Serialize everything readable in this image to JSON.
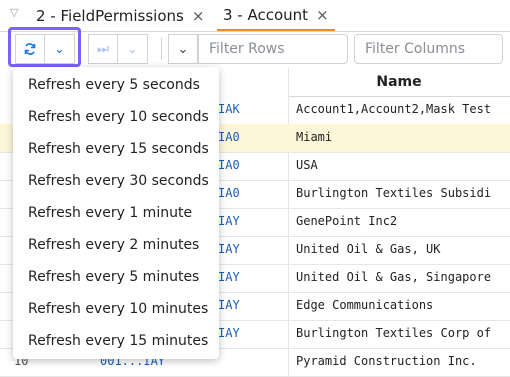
{
  "tabs": [
    {
      "label": "2 - FieldPermissions",
      "close": "×"
    },
    {
      "label": "3 - Account",
      "close": "×"
    }
  ],
  "toolbar": {
    "filter_rows_placeholder": "Filter Rows",
    "filter_columns_placeholder": "Filter Columns"
  },
  "grid": {
    "name_header": "Name",
    "rows": [
      {
        "id": "IAK",
        "name": "Account1,Account2,Mask Test"
      },
      {
        "id": "IA0",
        "name": "Miami"
      },
      {
        "id": "IA0",
        "name": "USA"
      },
      {
        "id": "IA0",
        "name": "Burlington Textiles Subsidi"
      },
      {
        "id": "IAY",
        "name": "GenePoint Inc2"
      },
      {
        "id": "IAY",
        "name": "United Oil & Gas, UK"
      },
      {
        "id": "IAY",
        "name": "United Oil & Gas, Singapore"
      },
      {
        "id": "IAY",
        "name": "Edge Communications"
      },
      {
        "id": "IAY",
        "name": "Burlington Textiles Corp of"
      },
      {
        "num": "10",
        "id": "001...IAY",
        "name": "Pyramid Construction Inc."
      }
    ]
  },
  "refresh_menu": {
    "items": [
      "Refresh every 5 seconds",
      "Refresh every 10 seconds",
      "Refresh every 15 seconds",
      "Refresh every 30 seconds",
      "Refresh every 1 minute",
      "Refresh every 2 minutes",
      "Refresh every 5 minutes",
      "Refresh every 10 minutes",
      "Refresh every 15 minutes"
    ]
  }
}
